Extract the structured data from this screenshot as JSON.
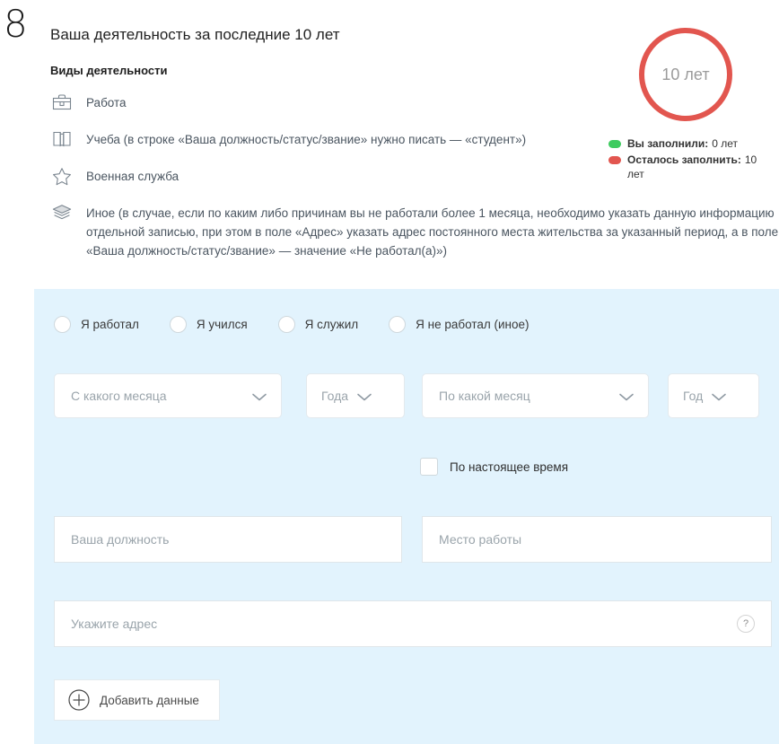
{
  "step": {
    "number": "8"
  },
  "header": {
    "title": "Ваша деятельность за последние 10 лет",
    "subtitle": "Виды деятельности"
  },
  "activities": [
    {
      "icon": "briefcase-icon",
      "text": "Работа"
    },
    {
      "icon": "book-icon",
      "text": "Учеба (в строке «Ваша должность/статус/звание» нужно писать — «студент»)"
    },
    {
      "icon": "star-icon",
      "text": "Военная служба"
    },
    {
      "icon": "layers-icon",
      "text": "Иное (в случае, если по каким либо причинам вы не работали более 1 месяца, необходимо указать данную информацию отдельной записью, при этом в поле «Адрес» указать адрес постоянного места жительства за указанный период, а в поле «Ваша должность/статус/звание» — значение «Не работал(а)»)"
    }
  ],
  "progress": {
    "center_label": "10 лет",
    "filled_color": "#3ecb5f",
    "remaining_color": "#e2564f",
    "legend": [
      {
        "color": "#3ecb5f",
        "label": "Вы заполнили:",
        "value": "0 лет"
      },
      {
        "color": "#e2564f",
        "label": "Осталось заполнить:",
        "value": "10 лет"
      }
    ]
  },
  "form": {
    "radios": [
      {
        "label": "Я работал",
        "checked": false
      },
      {
        "label": "Я учился",
        "checked": false
      },
      {
        "label": "Я служил",
        "checked": false
      },
      {
        "label": "Я не работал (иное)",
        "checked": false
      }
    ],
    "selects": [
      {
        "name": "from-month",
        "placeholder": "С какого месяца",
        "value": ""
      },
      {
        "name": "from-year",
        "placeholder": "Года",
        "value": ""
      },
      {
        "name": "to-month",
        "placeholder": "По какой месяц",
        "value": ""
      },
      {
        "name": "to-year",
        "placeholder": "Год",
        "value": ""
      }
    ],
    "checkbox": {
      "label": "По настоящее время",
      "checked": false
    },
    "inputs": [
      {
        "name": "position",
        "placeholder": "Ваша должность",
        "value": ""
      },
      {
        "name": "workplace",
        "placeholder": "Место работы",
        "value": ""
      },
      {
        "name": "address",
        "placeholder": "Укажите адрес",
        "value": "",
        "help": "?"
      }
    ],
    "add_button": {
      "label": "Добавить данные",
      "icon": "plus-circle-icon"
    }
  },
  "colors": {
    "panel_bg": "#e2f3fd",
    "accent_red": "#e2564f",
    "accent_green": "#3ecb5f"
  }
}
